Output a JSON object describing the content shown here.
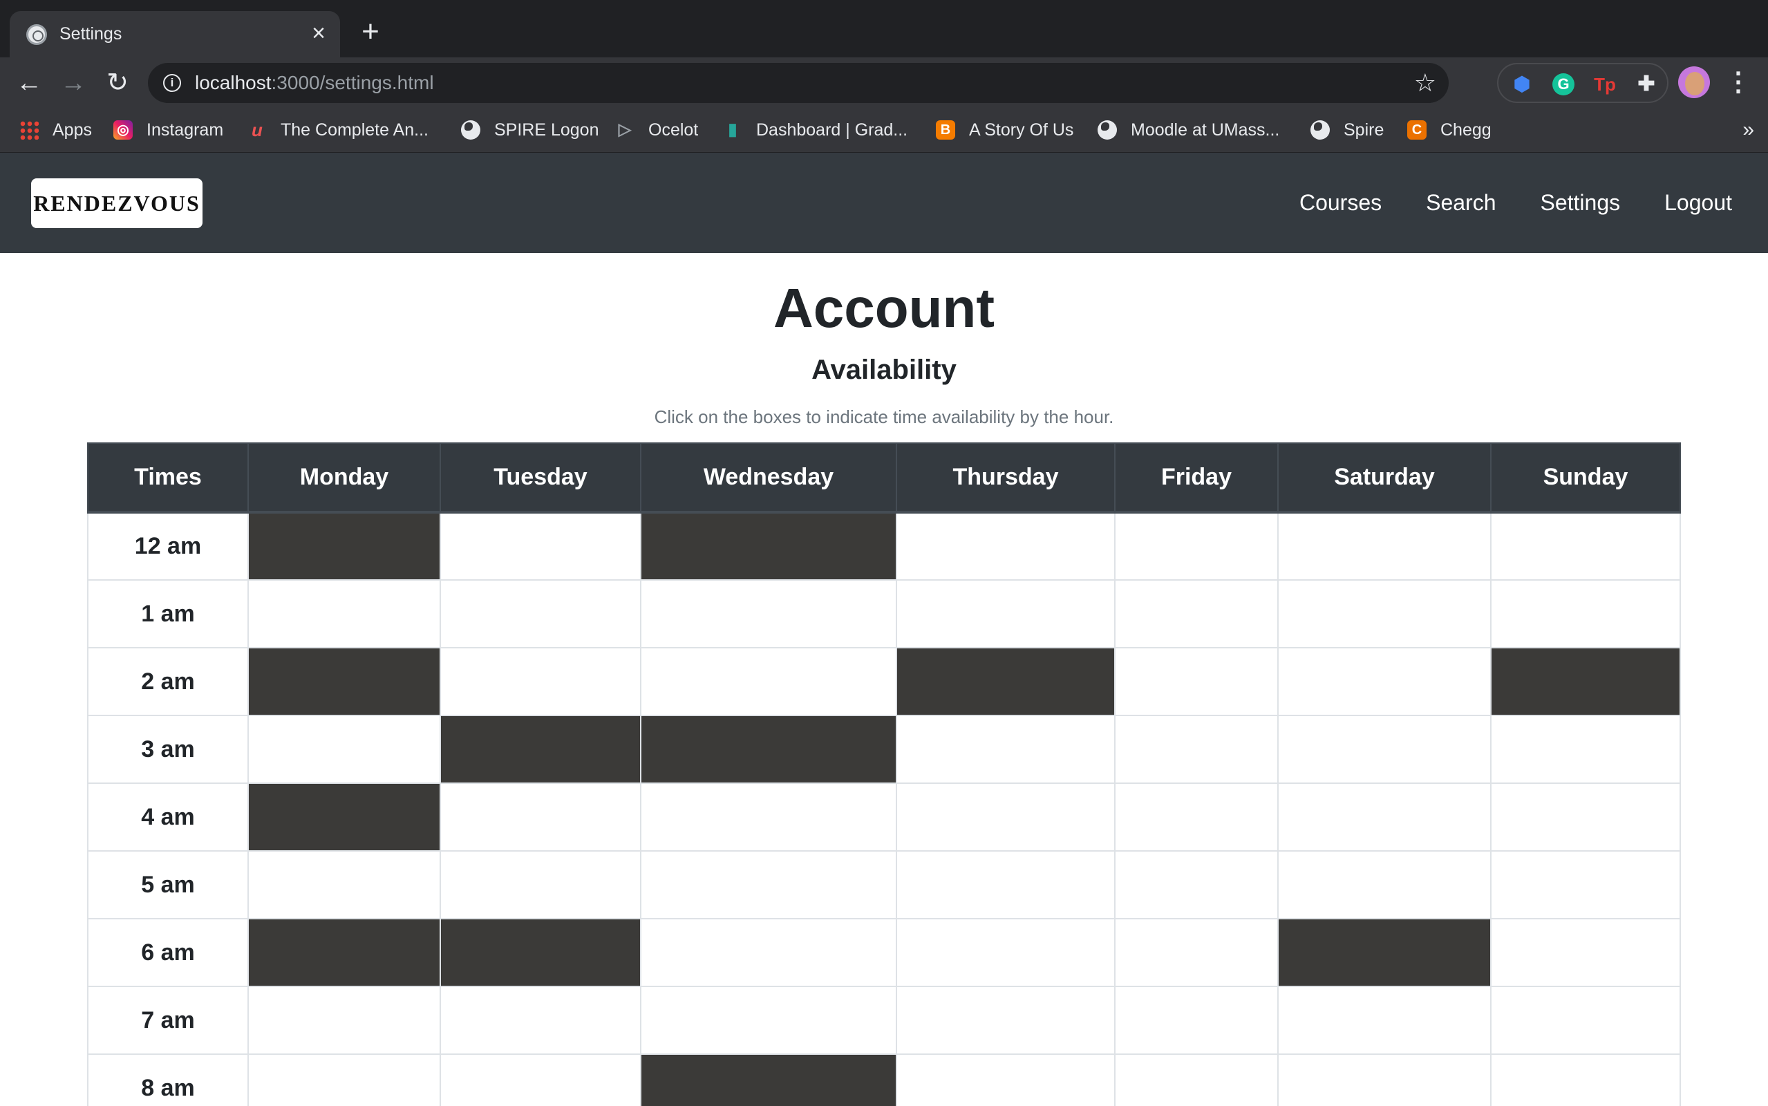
{
  "browser": {
    "tab_title": "Settings",
    "url_host": "localhost",
    "url_path": ":3000/settings.html",
    "bookmarks": [
      {
        "label": "Apps",
        "icon": "apps-grid-icon"
      },
      {
        "label": "Instagram",
        "icon": "instagram-icon"
      },
      {
        "label": "The Complete An...",
        "icon": "udemy-icon"
      },
      {
        "label": "SPIRE Logon",
        "icon": "globe-icon"
      },
      {
        "label": "Ocelot",
        "icon": "ocelot-icon"
      },
      {
        "label": "Dashboard | Grad...",
        "icon": "bar-chart-icon"
      },
      {
        "label": "A Story Of Us",
        "icon": "blogger-icon"
      },
      {
        "label": "Moodle at UMass...",
        "icon": "globe-icon"
      },
      {
        "label": "Spire",
        "icon": "globe-icon"
      },
      {
        "label": "Chegg",
        "icon": "chegg-icon"
      }
    ],
    "bookmarks_more": "»",
    "colors": {
      "chrome_dark": "#202124",
      "chrome_toolbar": "#35363a"
    }
  },
  "navbar": {
    "brand": "RENDEZVOUS",
    "links": [
      "Courses",
      "Search",
      "Settings",
      "Logout"
    ]
  },
  "page": {
    "title": "Account",
    "subtitle": "Availability",
    "instructions": "Click on the boxes to indicate time availability by the hour."
  },
  "schedule": {
    "headers": [
      "Times",
      "Monday",
      "Tuesday",
      "Wednesday",
      "Thursday",
      "Friday",
      "Saturday",
      "Sunday"
    ],
    "rows": [
      {
        "time": "12 am",
        "selected": [
          true,
          false,
          true,
          false,
          false,
          false,
          false
        ]
      },
      {
        "time": "1 am",
        "selected": [
          false,
          false,
          false,
          false,
          false,
          false,
          false
        ]
      },
      {
        "time": "2 am",
        "selected": [
          true,
          false,
          false,
          true,
          false,
          false,
          true
        ]
      },
      {
        "time": "3 am",
        "selected": [
          false,
          true,
          true,
          false,
          false,
          false,
          false
        ]
      },
      {
        "time": "4 am",
        "selected": [
          true,
          false,
          false,
          false,
          false,
          false,
          false
        ]
      },
      {
        "time": "5 am",
        "selected": [
          false,
          false,
          false,
          false,
          false,
          false,
          false
        ]
      },
      {
        "time": "6 am",
        "selected": [
          true,
          true,
          false,
          false,
          false,
          true,
          false
        ]
      },
      {
        "time": "7 am",
        "selected": [
          false,
          false,
          false,
          false,
          false,
          false,
          false
        ]
      },
      {
        "time": "8 am",
        "selected": [
          false,
          false,
          true,
          false,
          false,
          false,
          false
        ]
      }
    ],
    "colors": {
      "selected": "#3b3a38",
      "header": "#343a40"
    }
  }
}
